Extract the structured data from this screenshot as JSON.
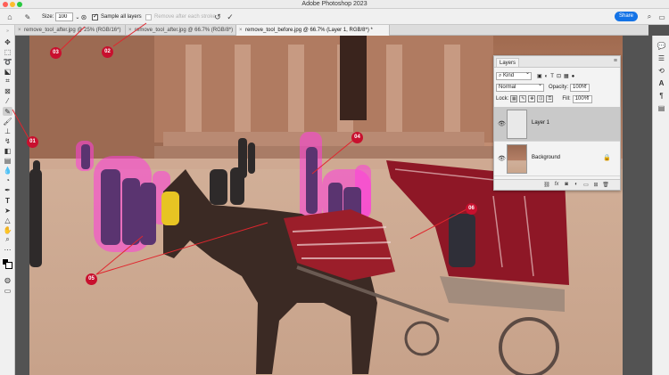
{
  "window": {
    "title": "Adobe Photoshop 2023",
    "traffic_colors": [
      "#ff5f57",
      "#febc2e",
      "#28c840"
    ]
  },
  "options_bar": {
    "size_label": "Size:",
    "size_value": "100",
    "sample_all_layers_label": "Sample all layers",
    "sample_all_layers_checked": true,
    "remove_after_stroke_label": "Remove after each stroke",
    "remove_after_stroke_checked": false,
    "share_label": "Share"
  },
  "tabs": [
    {
      "label": "remove_tool_after.jpg @ 25% (RGB/16*)",
      "active": false
    },
    {
      "label": "remove_tool_after.jpg @ 66.7% (RGB/8*)",
      "active": false
    },
    {
      "label": "remove_tool_before.jpg @ 66.7% (Layer 1, RGB/8*) *",
      "active": true
    }
  ],
  "layers_panel": {
    "tab_label": "Layers",
    "filter_kind": "Kind",
    "blend_mode": "Normal",
    "opacity_label": "Opacity:",
    "opacity_value": "100%",
    "lock_label": "Lock:",
    "fill_label": "Fill:",
    "fill_value": "100%",
    "layers": [
      {
        "name": "Layer 1",
        "selected": true,
        "locked": false
      },
      {
        "name": "Background",
        "selected": false,
        "locked": true
      }
    ],
    "footer_icons": [
      "link-icon",
      "fx-icon",
      "mask-icon",
      "adjustment-icon",
      "group-icon",
      "new-layer-icon",
      "trash-icon"
    ],
    "fx_label": "fx"
  },
  "callouts": [
    "01",
    "02",
    "03",
    "04",
    "05",
    "06"
  ],
  "colors": {
    "accent": "#1473e6",
    "callout": "#c8102e",
    "highlight": "#ff3cdc"
  }
}
